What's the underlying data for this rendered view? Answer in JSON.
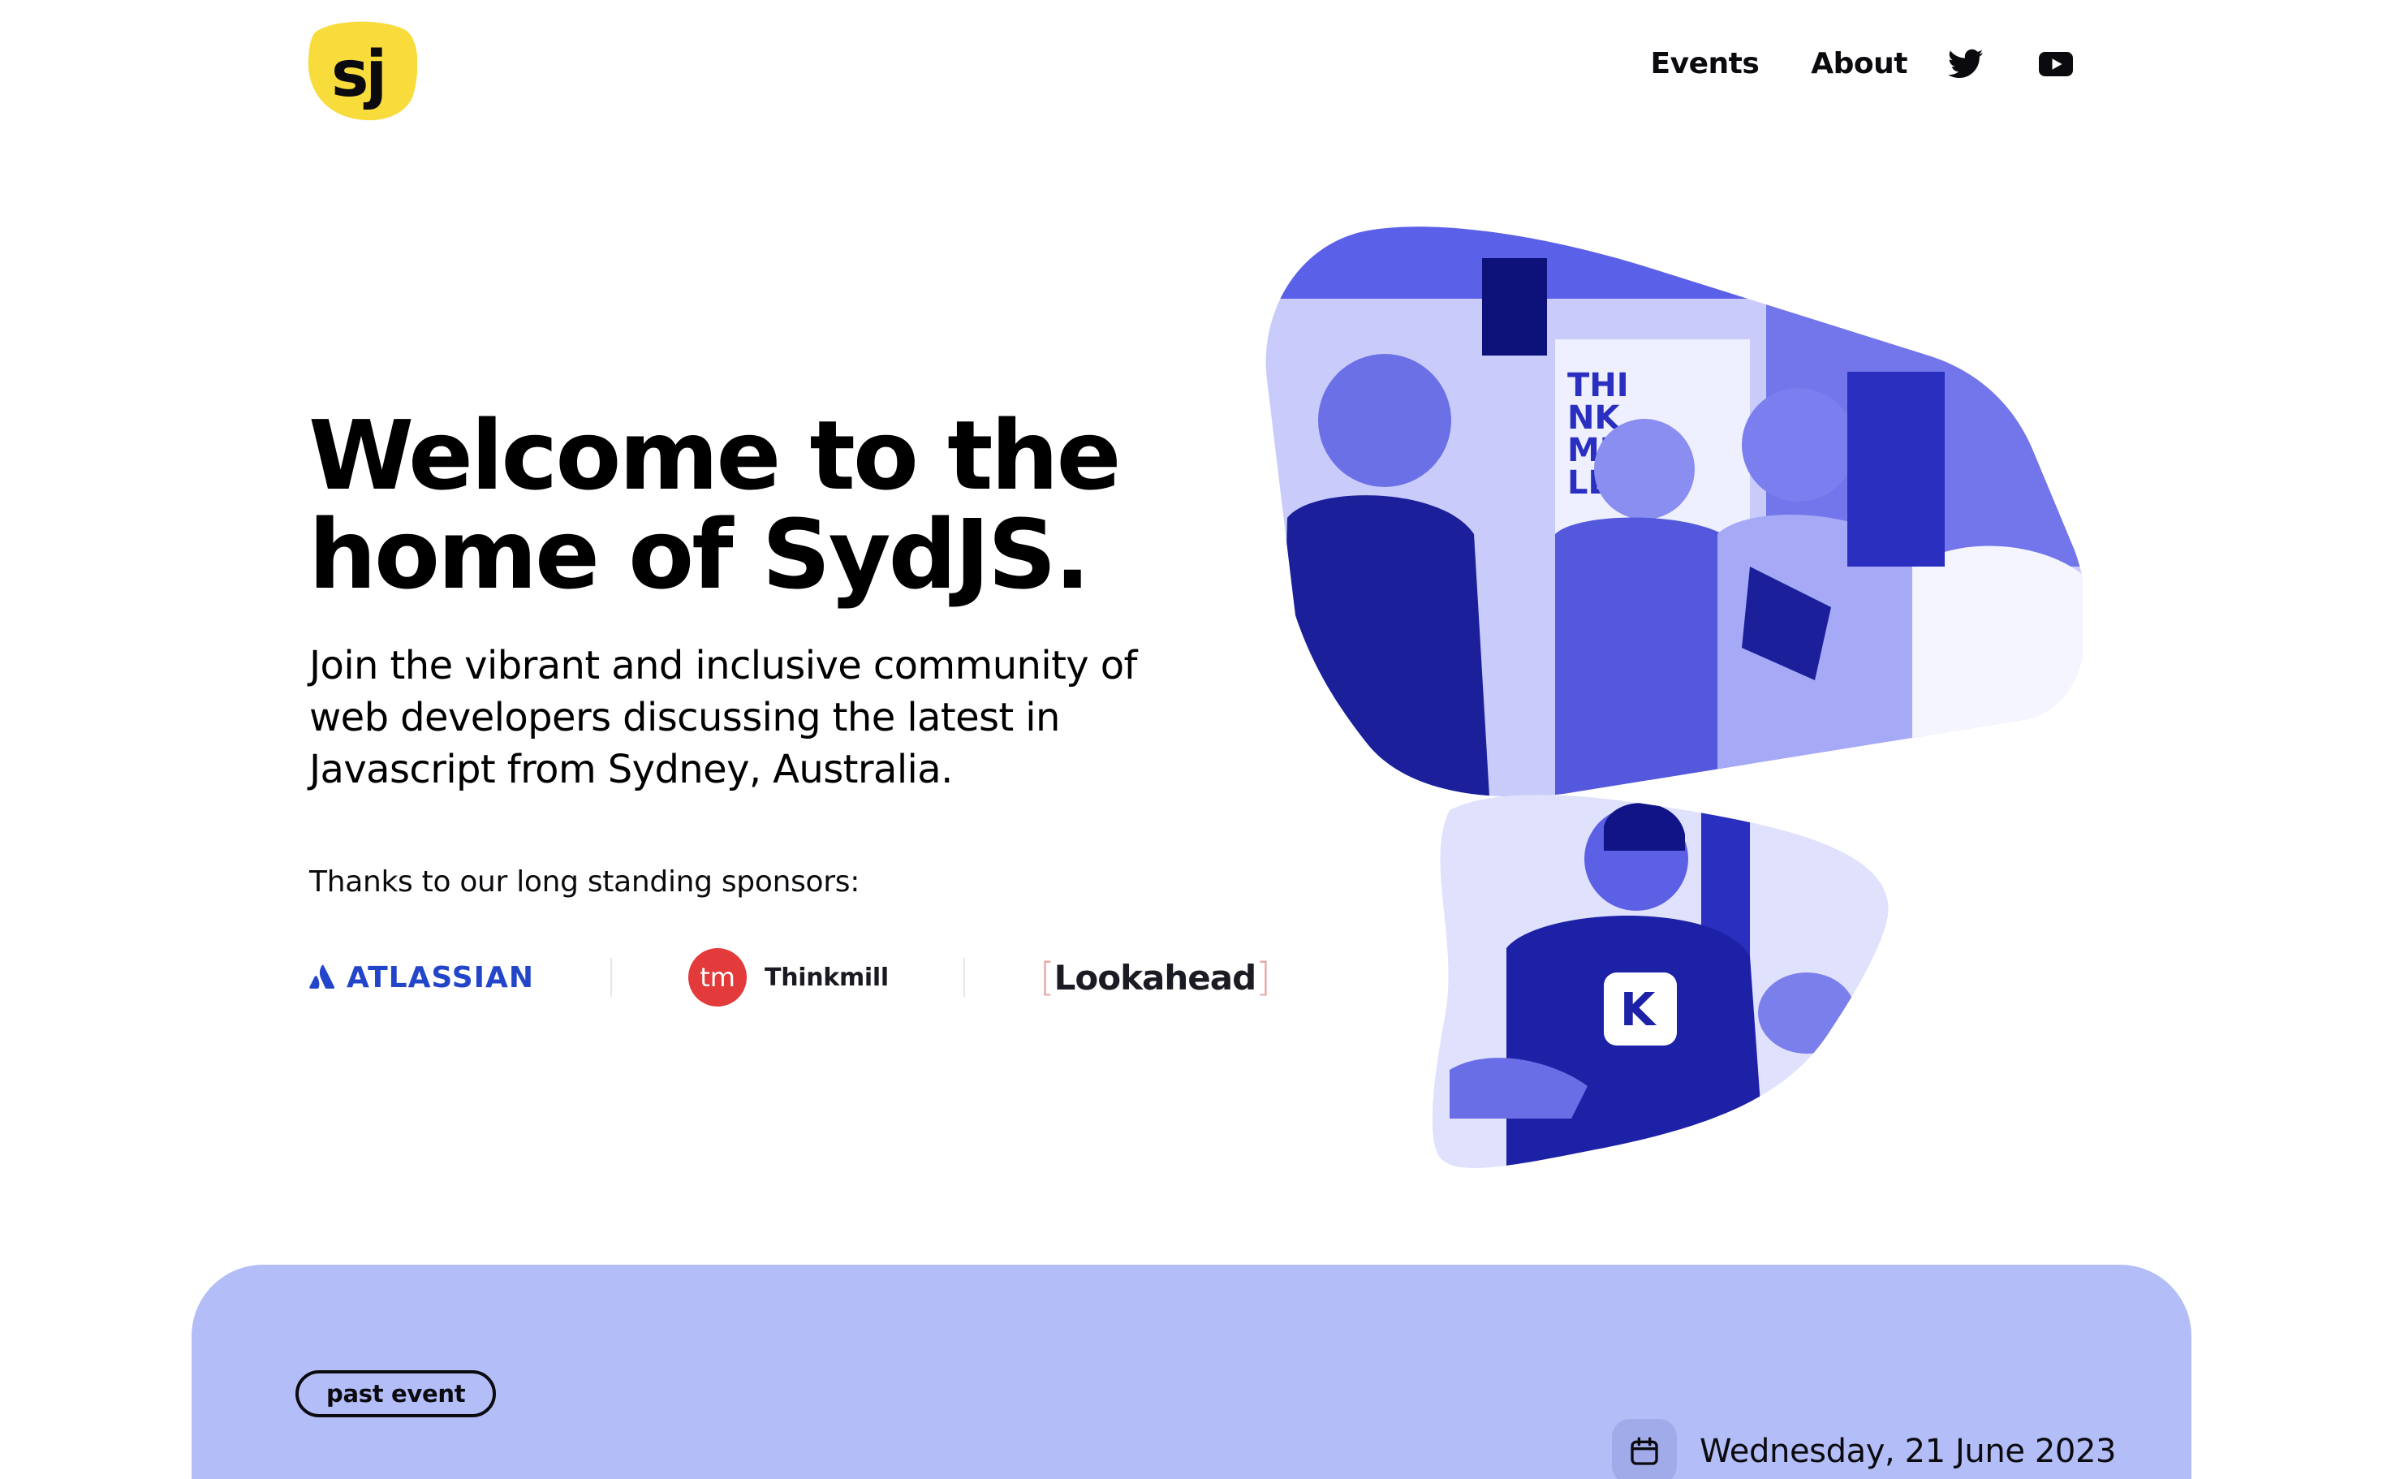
{
  "header": {
    "logo_text": "sj",
    "nav": {
      "events": "Events",
      "about": "About",
      "twitter_icon": "twitter-icon",
      "youtube_icon": "youtube-icon"
    }
  },
  "hero": {
    "title_line1": "Welcome to the",
    "title_line2": "home of SydJS.",
    "subtitle": "Join the vibrant and inclusive community of web developers discussing the latest in Javascript from Sydney, Australia.",
    "sponsors_label": "Thanks to our long standing sponsors:",
    "sponsors": [
      {
        "name": "ATLASSIAN",
        "color": "#2245c9"
      },
      {
        "mark": "tm",
        "name": "Thinkmill",
        "color": "#e33b3b"
      },
      {
        "name": "Lookahead",
        "color": "#1b1b24"
      }
    ],
    "photo_tint": "#4b50e0"
  },
  "event": {
    "badge": "past event",
    "date": "Wednesday, 21 June 2023",
    "calendar_icon": "calendar-icon",
    "card_color": "#b3bdf7"
  }
}
